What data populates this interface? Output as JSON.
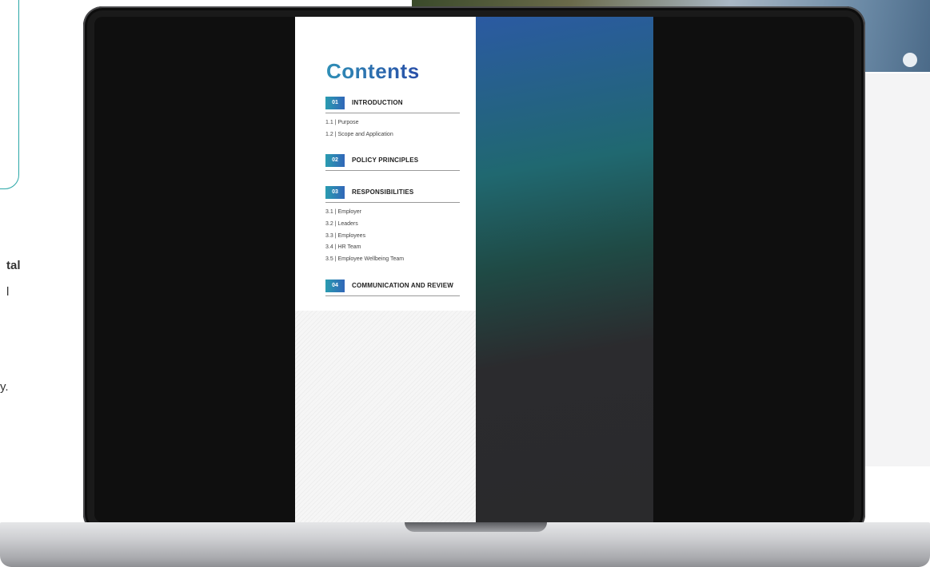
{
  "background": {
    "text_fragments": [
      "tal",
      "l",
      "y."
    ]
  },
  "document": {
    "title": "Contents",
    "sections": [
      {
        "number": "01",
        "title": "INTRODUCTION",
        "items": [
          "1.1 | Purpose",
          "1.2 | Scope and Application"
        ]
      },
      {
        "number": "02",
        "title": "POLICY PRINCIPLES",
        "items": []
      },
      {
        "number": "03",
        "title": "RESPONSIBILITIES",
        "items": [
          "3.1 | Employer",
          "3.2 | Leaders",
          "3.3 | Employees",
          "3.4 | HR Team",
          "3.5 | Employee Wellbeing Team"
        ]
      },
      {
        "number": "04",
        "title": "COMMUNICATION AND REVIEW",
        "items": []
      }
    ]
  },
  "colors": {
    "accent_teal": "#2aa7a7",
    "badge_gradient_start": "#2a9cb0",
    "badge_gradient_end": "#3167b8",
    "title_blue": "#2a4fa8"
  }
}
